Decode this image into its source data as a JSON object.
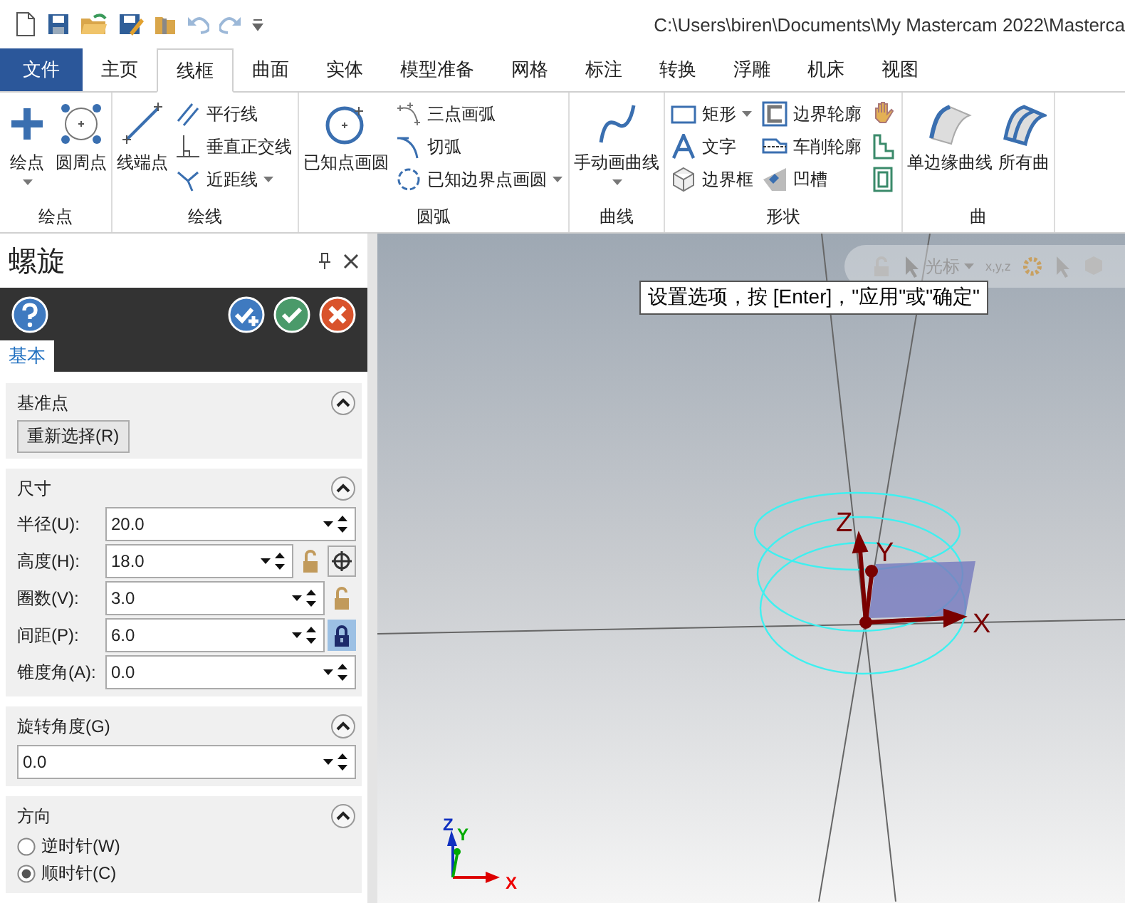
{
  "title_bar": {
    "path": "C:\\Users\\biren\\Documents\\My Mastercam 2022\\Masterca"
  },
  "tabs": [
    {
      "label": "文件",
      "kind": "file",
      "selected": false
    },
    {
      "label": "主页",
      "kind": "tab",
      "selected": false
    },
    {
      "label": "线框",
      "kind": "tab",
      "selected": true
    },
    {
      "label": "曲面",
      "kind": "tab",
      "selected": false
    },
    {
      "label": "实体",
      "kind": "tab",
      "selected": false
    },
    {
      "label": "模型准备",
      "kind": "tab",
      "selected": false
    },
    {
      "label": "网格",
      "kind": "tab",
      "selected": false
    },
    {
      "label": "标注",
      "kind": "tab",
      "selected": false
    },
    {
      "label": "转换",
      "kind": "tab",
      "selected": false
    },
    {
      "label": "浮雕",
      "kind": "tab",
      "selected": false
    },
    {
      "label": "机床",
      "kind": "tab",
      "selected": false
    },
    {
      "label": "视图",
      "kind": "tab",
      "selected": false
    }
  ],
  "ribbon": {
    "groups": [
      {
        "label": "绘点",
        "large": [
          {
            "label": "绘点",
            "dropdown": true
          },
          {
            "label": "圆周点",
            "dropdown": false
          }
        ]
      },
      {
        "label": "绘线",
        "large": [
          {
            "label": "线端点",
            "dropdown": false
          }
        ],
        "columns": [
          [
            {
              "kind": "text",
              "label": "平行线",
              "dropdown": false
            },
            {
              "kind": "text",
              "label": "垂直正交线",
              "dropdown": false
            },
            {
              "kind": "text",
              "label": "近距线",
              "dropdown": true
            }
          ]
        ]
      },
      {
        "label": "圆弧",
        "large": [
          {
            "label": "已知点画圆",
            "dropdown": false
          }
        ],
        "columns": [
          [
            {
              "kind": "text",
              "label": "三点画弧",
              "dropdown": false
            },
            {
              "kind": "text",
              "label": "切弧",
              "dropdown": false
            },
            {
              "kind": "text",
              "label": "已知边界点画圆",
              "dropdown": true
            }
          ]
        ]
      },
      {
        "label": "曲线",
        "large": [
          {
            "label": "手动画曲线",
            "dropdown": true
          }
        ]
      },
      {
        "label": "形状",
        "columns": [
          [
            {
              "kind": "text",
              "label": "矩形",
              "dropdown": true
            },
            {
              "kind": "text",
              "label": "文字",
              "dropdown": false
            },
            {
              "kind": "text",
              "label": "边界框",
              "dropdown": false
            }
          ],
          [
            {
              "kind": "text",
              "label": "边界轮廓",
              "dropdown": false
            },
            {
              "kind": "text",
              "label": "车削轮廓",
              "dropdown": false
            },
            {
              "kind": "text",
              "label": "凹槽",
              "dropdown": false
            }
          ],
          [
            {
              "kind": "icon"
            },
            {
              "kind": "icon"
            },
            {
              "kind": "icon"
            }
          ]
        ]
      },
      {
        "label": "曲",
        "large": [
          {
            "label": "单边缘曲线",
            "dropdown": false
          },
          {
            "label": "所有曲",
            "dropdown": false
          }
        ]
      }
    ]
  },
  "panel": {
    "title": "螺旋",
    "tabs": [
      {
        "label": "基本",
        "selected": true
      }
    ],
    "sections": [
      {
        "kind": "button",
        "title": "基准点",
        "expanded": true,
        "button": "重新选择(R)"
      },
      {
        "kind": "fields",
        "title": "尺寸",
        "expanded": true,
        "fields": [
          {
            "kind": "plain",
            "label": "半径(U):",
            "value": "20.0"
          },
          {
            "kind": "lock_target",
            "label": "高度(H):",
            "value": "18.0",
            "locked": false
          },
          {
            "kind": "lock",
            "label": "圈数(V):",
            "value": "3.0",
            "locked": false
          },
          {
            "kind": "lock",
            "label": "间距(P):",
            "value": "6.0",
            "locked": true
          },
          {
            "kind": "plain",
            "label": "锥度角(A):",
            "value": "0.0"
          }
        ]
      },
      {
        "kind": "field",
        "title": "旋转角度(G)",
        "expanded": true,
        "value": "0.0"
      },
      {
        "kind": "radios",
        "title": "方向",
        "expanded": true,
        "options": [
          {
            "label": "逆时针(W)",
            "selected": false
          },
          {
            "label": "顺时针(C)",
            "selected": true
          }
        ]
      }
    ]
  },
  "viewport": {
    "hint": "设置选项，按 [Enter]，\"应用\"或\"确定\"",
    "toolbar": {
      "label": "光标",
      "coords": "x,y,z"
    },
    "gnomon": {
      "x": "X",
      "y": "Y",
      "z": "Z"
    },
    "mini_gnomon": {
      "x": "X",
      "y": "Y",
      "z": "Z"
    }
  }
}
